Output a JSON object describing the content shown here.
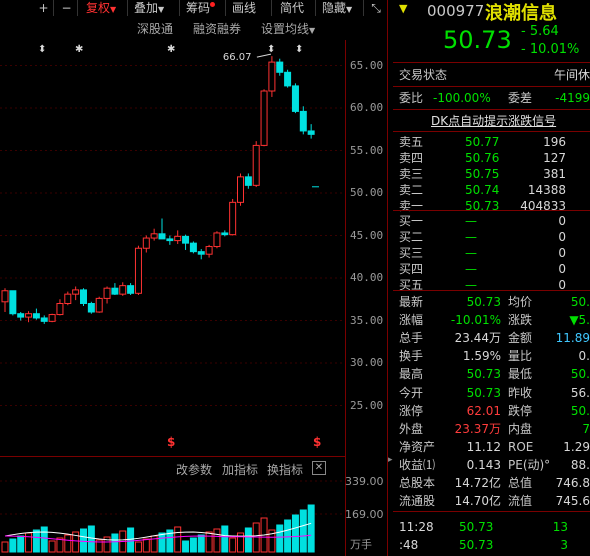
{
  "toolbar": {
    "items": [
      "+",
      "−",
      "复权",
      "叠加",
      "筹码",
      "画线",
      "简代",
      "隐藏"
    ]
  },
  "submenu": {
    "a": "深股通",
    "b": "融资融券",
    "c": "设置均线"
  },
  "chart_data": {
    "type": "candlestick",
    "ylim": [
      20,
      68
    ],
    "yticks": [
      "65.00",
      "60.00",
      "55.00",
      "50.00",
      "45.00",
      "40.00",
      "35.00",
      "30.00",
      "25.00"
    ],
    "ytick_values": [
      65,
      60,
      55,
      50,
      45,
      40,
      35,
      30,
      25
    ],
    "max_label": "66.07",
    "last_price": 50.73,
    "candles": [
      [
        37.2,
        38.8,
        36.0,
        38.5
      ],
      [
        38.5,
        38.2,
        35.6,
        35.8
      ],
      [
        35.8,
        36.0,
        35.0,
        35.4
      ],
      [
        35.4,
        36.1,
        34.8,
        35.8
      ],
      [
        35.8,
        36.4,
        35.1,
        35.3
      ],
      [
        35.3,
        35.6,
        34.6,
        34.9
      ],
      [
        34.9,
        35.8,
        34.8,
        35.7
      ],
      [
        35.7,
        37.5,
        35.6,
        37.0
      ],
      [
        37.0,
        38.4,
        36.8,
        38.1
      ],
      [
        38.1,
        39.0,
        37.4,
        38.6
      ],
      [
        38.6,
        38.8,
        36.7,
        37.0
      ],
      [
        37.0,
        37.2,
        35.8,
        36.0
      ],
      [
        36.0,
        37.8,
        35.9,
        37.6
      ],
      [
        37.6,
        39.0,
        37.0,
        38.8
      ],
      [
        38.8,
        39.4,
        38.0,
        38.1
      ],
      [
        38.1,
        39.5,
        37.9,
        39.1
      ],
      [
        39.1,
        39.4,
        38.0,
        38.2
      ],
      [
        38.2,
        43.8,
        38.0,
        43.5
      ],
      [
        43.5,
        45.0,
        43.0,
        44.7
      ],
      [
        44.7,
        45.8,
        44.4,
        45.2
      ],
      [
        45.2,
        47.0,
        45.0,
        44.6
      ],
      [
        44.6,
        45.0,
        43.9,
        44.4
      ],
      [
        44.4,
        45.6,
        44.0,
        44.9
      ],
      [
        44.9,
        45.1,
        43.3,
        44.1
      ],
      [
        44.1,
        44.3,
        42.9,
        43.1
      ],
      [
        43.1,
        43.4,
        42.2,
        42.8
      ],
      [
        42.8,
        43.9,
        42.4,
        43.7
      ],
      [
        43.7,
        45.5,
        43.5,
        45.3
      ],
      [
        45.3,
        45.6,
        44.9,
        45.1
      ],
      [
        45.1,
        49.3,
        45.0,
        48.9
      ],
      [
        48.9,
        52.3,
        48.5,
        51.9
      ],
      [
        51.9,
        52.3,
        50.5,
        50.9
      ],
      [
        50.9,
        56.1,
        50.7,
        55.6
      ],
      [
        55.6,
        62.2,
        55.5,
        62.0
      ],
      [
        62.0,
        66.1,
        61.3,
        65.4
      ],
      [
        65.4,
        65.8,
        63.8,
        64.2
      ],
      [
        64.2,
        64.5,
        62.4,
        62.6
      ],
      [
        62.6,
        62.9,
        59.4,
        59.6
      ],
      [
        59.6,
        60.2,
        56.9,
        57.3
      ],
      [
        57.3,
        58.1,
        56.4,
        56.9
      ]
    ],
    "volume_ticks": [
      "339.00",
      "169.00",
      "万手"
    ]
  },
  "volume_menu": {
    "a": "改参数",
    "b": "加指标",
    "c": "换指标"
  },
  "quote": {
    "code": "000977",
    "name": "浪潮信息",
    "price": "50.73",
    "change": "- 5.64",
    "change_pct": "- 10.01%",
    "status_label": "交易状态",
    "status_value": "午间休",
    "weibi_label": "委比",
    "weibi_value": "-100.00%",
    "weicha_label": "委差",
    "weicha_value": "-4199",
    "dk_signal": "DK点自动提示涨跌信号"
  },
  "asks": [
    {
      "label": "卖五",
      "price": "50.77",
      "vol": "196"
    },
    {
      "label": "卖四",
      "price": "50.76",
      "vol": "127"
    },
    {
      "label": "卖三",
      "price": "50.75",
      "vol": "381"
    },
    {
      "label": "卖二",
      "price": "50.74",
      "vol": "14388"
    },
    {
      "label": "卖一",
      "price": "50.73",
      "vol": "404833"
    }
  ],
  "bids": [
    {
      "label": "买一",
      "price": "—",
      "vol": "0"
    },
    {
      "label": "买二",
      "price": "—",
      "vol": "0"
    },
    {
      "label": "买三",
      "price": "—",
      "vol": "0"
    },
    {
      "label": "买四",
      "price": "—",
      "vol": "0"
    },
    {
      "label": "买五",
      "price": "—",
      "vol": "0"
    }
  ],
  "stats": [
    {
      "l1": "最新",
      "v1": "50.73",
      "c1": "g",
      "l2": "均价",
      "v2": "50.",
      "c2": "g"
    },
    {
      "l1": "涨幅",
      "v1": "-10.01%",
      "c1": "g",
      "l2": "涨跌",
      "v2": "▼5.",
      "c2": "g"
    },
    {
      "l1": "总手",
      "v1": "23.44万",
      "c1": "w",
      "l2": "金额",
      "v2": "11.89",
      "c2": "c"
    },
    {
      "l1": "换手",
      "v1": "1.59%",
      "c1": "w",
      "l2": "量比",
      "v2": "0.",
      "c2": "w"
    },
    {
      "l1": "最高",
      "v1": "50.73",
      "c1": "g",
      "l2": "最低",
      "v2": "50.",
      "c2": "g"
    },
    {
      "l1": "今开",
      "v1": "50.73",
      "c1": "g",
      "l2": "昨收",
      "v2": "56.",
      "c2": "w"
    },
    {
      "l1": "涨停",
      "v1": "62.01",
      "c1": "r",
      "l2": "跌停",
      "v2": "50.",
      "c2": "g"
    },
    {
      "l1": "外盘",
      "v1": "23.37万",
      "c1": "r",
      "l2": "内盘",
      "v2": "7",
      "c2": "g"
    },
    {
      "l1": "净资产",
      "v1": "11.12",
      "c1": "w",
      "l2": "ROE",
      "v2": "1.29",
      "c2": "w"
    },
    {
      "l1": "收益⑴",
      "v1": "0.143",
      "c1": "w",
      "l2": "PE(动)°",
      "v2": "88.",
      "c2": "w"
    },
    {
      "l1": "总股本",
      "v1": "14.72亿",
      "c1": "w",
      "l2": "总值",
      "v2": "746.8",
      "c2": "w"
    },
    {
      "l1": "流通股",
      "v1": "14.70亿",
      "c1": "w",
      "l2": "流值",
      "v2": "745.6",
      "c2": "w"
    }
  ],
  "ticks": [
    {
      "time": "11:28",
      "price": "50.73",
      "vol": "13"
    },
    {
      "time": ":48",
      "price": "50.73",
      "vol": "3"
    }
  ],
  "colors": {
    "up": "#ff3232",
    "down": "#00e0e0",
    "bg": "#000000",
    "grid": "#3a0000"
  }
}
